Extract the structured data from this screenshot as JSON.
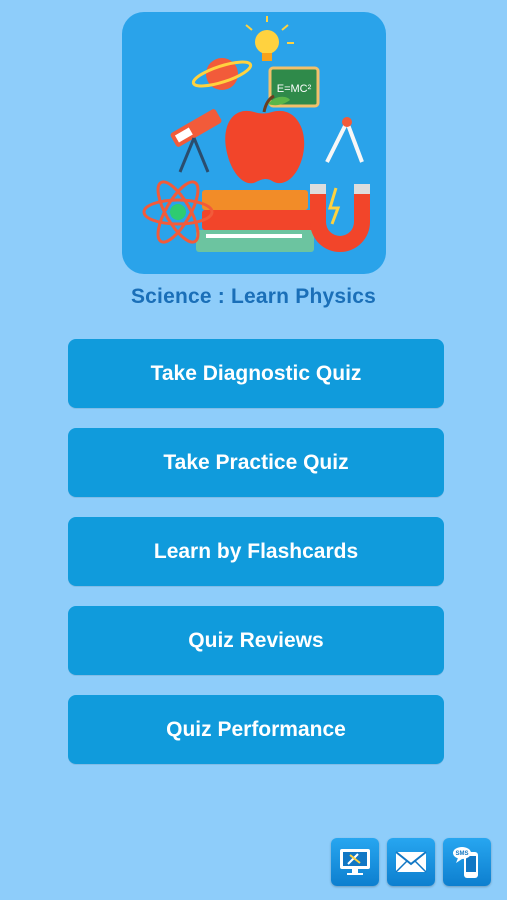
{
  "app": {
    "title": "Science : Learn Physics"
  },
  "menu": {
    "items": [
      {
        "label": "Take Diagnostic Quiz"
      },
      {
        "label": "Take Practice Quiz"
      },
      {
        "label": "Learn by Flashcards"
      },
      {
        "label": "Quiz Reviews"
      },
      {
        "label": "Quiz Performance"
      }
    ]
  },
  "bottom_bar": {
    "buttons": [
      {
        "icon": "desktop-tools-icon"
      },
      {
        "icon": "mail-icon"
      },
      {
        "icon": "sms-phone-icon"
      }
    ],
    "sms_text": "SMS"
  },
  "colors": {
    "background": "#8ecdfa",
    "button": "#109bdc",
    "title": "#1a6fb8",
    "icon_bg": "#2aa3ea"
  }
}
